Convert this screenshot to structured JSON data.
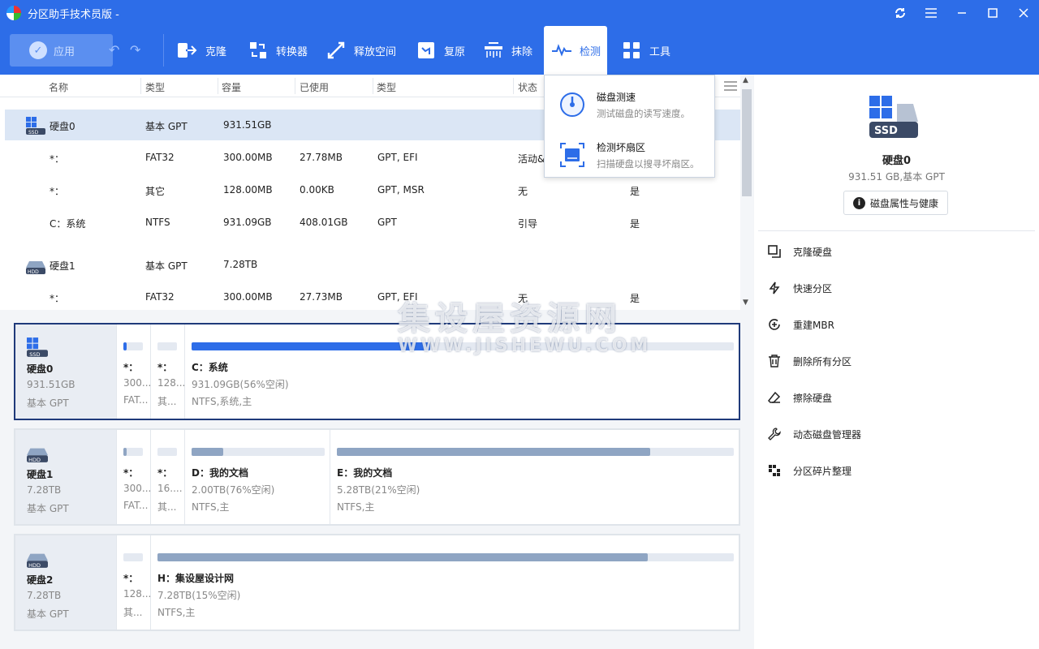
{
  "app": {
    "title": "分区助手技术员版 -"
  },
  "toolbar": {
    "apply": "应用",
    "tools": [
      {
        "label": "克隆",
        "icon": "clone-icon"
      },
      {
        "label": "转换器",
        "icon": "converter-icon"
      },
      {
        "label": "释放空间",
        "icon": "free-space-icon"
      },
      {
        "label": "复原",
        "icon": "restore-icon"
      },
      {
        "label": "抹除",
        "icon": "wipe-icon"
      },
      {
        "label": "检测",
        "icon": "detect-icon"
      },
      {
        "label": "工具",
        "icon": "tools-icon"
      }
    ]
  },
  "dropdown": {
    "items": [
      {
        "title": "磁盘测速",
        "desc": "测试磁盘的读写速度。"
      },
      {
        "title": "检测坏扇区",
        "desc": "扫描硬盘以搜寻坏扇区。"
      }
    ]
  },
  "table": {
    "headers": [
      "名称",
      "类型",
      "容量",
      "已使用",
      "类型",
      "状态"
    ],
    "rows": [
      {
        "name": "硬盘0",
        "type": "基本 GPT",
        "cap": "931.51GB",
        "used": "",
        "ptype": "",
        "status": "",
        "flag": "",
        "disk": "SSD"
      },
      {
        "name": "*：",
        "type": "FAT32",
        "cap": "300.00MB",
        "used": "27.78MB",
        "ptype": "GPT, EFI",
        "status": "活动&",
        "flag": ""
      },
      {
        "name": "*：",
        "type": "其它",
        "cap": "128.00MB",
        "used": "0.00KB",
        "ptype": "GPT, MSR",
        "status": "无",
        "flag": "是"
      },
      {
        "name": "C：系统",
        "type": "NTFS",
        "cap": "931.09GB",
        "used": "408.01GB",
        "ptype": "GPT",
        "status": "引导",
        "flag": "是"
      },
      {
        "name": "硬盘1",
        "type": "基本 GPT",
        "cap": "7.28TB",
        "used": "",
        "ptype": "",
        "status": "",
        "flag": "",
        "disk": "HDD"
      },
      {
        "name": "*：",
        "type": "FAT32",
        "cap": "300.00MB",
        "used": "27.73MB",
        "ptype": "GPT, EFI",
        "status": "无",
        "flag": "是"
      }
    ]
  },
  "disks": [
    {
      "name": "硬盘0",
      "size": "931.51GB",
      "type": "基本 GPT",
      "kind": "SSD",
      "parts": [
        {
          "name": "*：",
          "info": "300...",
          "fs": "FAT...",
          "fill": 0.15,
          "color": "#2d6de8"
        },
        {
          "name": "*：",
          "info": "128...",
          "fs": "其...",
          "fill": 0,
          "color": "#2d6de8"
        },
        {
          "name": "C：系统",
          "info": "931.09GB(56%空闲)",
          "fs": "NTFS,系统,主",
          "fill": 0.44,
          "color": "#2d6de8"
        }
      ]
    },
    {
      "name": "硬盘1",
      "size": "7.28TB",
      "type": "基本 GPT",
      "kind": "HDD",
      "parts": [
        {
          "name": "*：",
          "info": "300...",
          "fs": "FAT...",
          "fill": 0.15,
          "color": "#8fa5c3"
        },
        {
          "name": "*：",
          "info": "16....",
          "fs": "其...",
          "fill": 0,
          "color": "#8fa5c3"
        },
        {
          "name": "D：我的文档",
          "info": "2.00TB(76%空闲)",
          "fs": "NTFS,主",
          "fill": 0.24,
          "color": "#8fa5c3"
        },
        {
          "name": "E：我的文档",
          "info": "5.28TB(21%空闲)",
          "fs": "NTFS,主",
          "fill": 0.79,
          "color": "#8fa5c3"
        }
      ]
    },
    {
      "name": "硬盘2",
      "size": "7.28TB",
      "type": "基本 GPT",
      "kind": "HDD",
      "parts": [
        {
          "name": "*：",
          "info": "128...",
          "fs": "其...",
          "fill": 0,
          "color": "#8fa5c3"
        },
        {
          "name": "H：集设屋设计网",
          "info": "7.28TB(15%空闲)",
          "fs": "NTFS,主",
          "fill": 0.85,
          "color": "#8fa5c3"
        }
      ]
    }
  ],
  "right": {
    "disk_name": "硬盘0",
    "disk_info": "931.51 GB,基本 GPT",
    "props_btn": "磁盘属性与健康",
    "ops": [
      {
        "label": "克隆硬盘",
        "icon": "clone-disk-icon"
      },
      {
        "label": "快速分区",
        "icon": "lightning-icon"
      },
      {
        "label": "重建MBR",
        "icon": "rebuild-mbr-icon"
      },
      {
        "label": "删除所有分区",
        "icon": "trash-icon"
      },
      {
        "label": "擦除硬盘",
        "icon": "eraser-icon"
      },
      {
        "label": "动态磁盘管理器",
        "icon": "wrench-icon"
      },
      {
        "label": "分区碎片整理",
        "icon": "defrag-icon"
      }
    ]
  },
  "watermark": {
    "line1": "集设屋资源网",
    "line2": "WWW.JISHEWU.COM"
  },
  "colors": {
    "accent": "#2d6de8",
    "selected_row": "#dbe6f5",
    "hdd_bar": "#8fa5c3"
  }
}
